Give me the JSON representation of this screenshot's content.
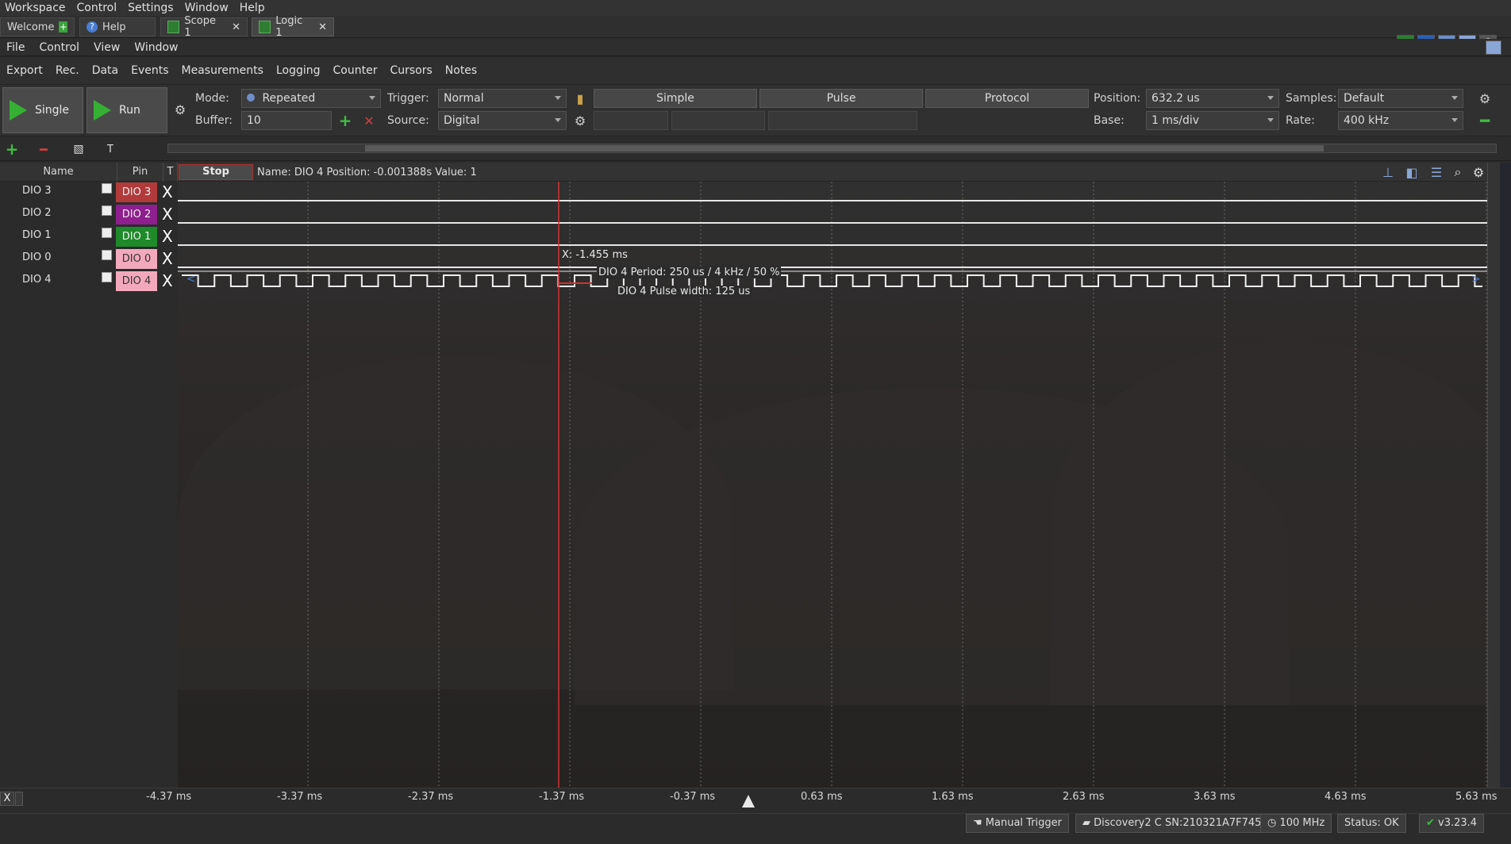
{
  "menubar": [
    "Workspace",
    "Control",
    "Settings",
    "Window",
    "Help"
  ],
  "tabs": [
    {
      "label": "Welcome",
      "icon": "plus-icon"
    },
    {
      "label": "Help",
      "icon": "help-icon"
    },
    {
      "label": "Scope 1",
      "close": "✕"
    },
    {
      "label": "Logic 1",
      "close": "✕"
    }
  ],
  "menu2": [
    "File",
    "Control",
    "View",
    "Window"
  ],
  "menu3": [
    "Export",
    "Rec.",
    "Data",
    "Events",
    "Measurements",
    "Logging",
    "Counter",
    "Cursors",
    "Notes"
  ],
  "toolbar": {
    "single": "Single",
    "run": "Run",
    "mode_label": "Mode:",
    "mode_value": "Repeated",
    "buffer_label": "Buffer:",
    "buffer_value": "10",
    "trigger_label": "Trigger:",
    "trigger_value": "Normal",
    "source_label": "Source:",
    "source_value": "Digital",
    "simple": "Simple",
    "pulse": "Pulse",
    "protocol": "Protocol",
    "position_label": "Position:",
    "position_value": "632.2 us",
    "base_label": "Base:",
    "base_value": "1 ms/div",
    "samples_label": "Samples:",
    "samples_value": "Default",
    "rate_label": "Rate:",
    "rate_value": "400 kHz"
  },
  "headers": {
    "name": "Name",
    "pin": "Pin",
    "t": "T",
    "stop": "Stop"
  },
  "info_text": "Name: DIO  4  Position: -0.001388s  Value: 1",
  "channels": [
    {
      "name": "DIO  3",
      "pin": "DIO  3",
      "color": "#b23a3a",
      "x": "X"
    },
    {
      "name": "DIO  2",
      "pin": "DIO  2",
      "color": "#8f1f8f",
      "x": "X"
    },
    {
      "name": "DIO  1",
      "pin": "DIO  1",
      "color": "#1f8a2a",
      "x": "X"
    },
    {
      "name": "DIO  0",
      "pin": "DIO  0",
      "color": "#f3a9bd",
      "x": "X"
    },
    {
      "name": "DIO  4",
      "pin": "DIO  4",
      "color": "#f3a9bd",
      "x": "X"
    }
  ],
  "cursor": {
    "label": "X: -1.455 ms",
    "period": "DIO  4 Period: 250 us / 4 kHz / 50 %",
    "pulse": "DIO  4 Pulse width: 125 us",
    "color": "#d03030"
  },
  "axis": [
    "-4.37 ms",
    "-3.37 ms",
    "-2.37 ms",
    "-1.37 ms",
    "-0.37 ms",
    "0.63 ms",
    "1.63 ms",
    "2.63 ms",
    "3.63 ms",
    "4.63 ms",
    "5.63 ms"
  ],
  "bottom_x": "X",
  "status": {
    "manual_trigger": "Manual Trigger",
    "device": "Discovery2 C SN:210321A7F745",
    "clock": "100 MHz",
    "status": "Status: OK",
    "version": "v3.23.4"
  }
}
